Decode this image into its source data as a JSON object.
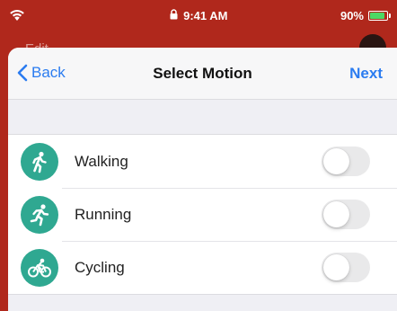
{
  "status_bar": {
    "time": "9:41 AM",
    "battery": "90%",
    "battery_level": 0.9,
    "accent_color": "#b0281c"
  },
  "background_app": {
    "edit_label": "Edit"
  },
  "nav": {
    "back_label": "Back",
    "title": "Select Motion",
    "next_label": "Next",
    "tint_color": "#2b7cf0"
  },
  "motions": [
    {
      "label": "Walking",
      "icon": "walking-icon",
      "enabled": false
    },
    {
      "label": "Running",
      "icon": "running-icon",
      "enabled": false
    },
    {
      "label": "Cycling",
      "icon": "cycling-icon",
      "enabled": false
    }
  ],
  "icon_color": "#2fa891"
}
